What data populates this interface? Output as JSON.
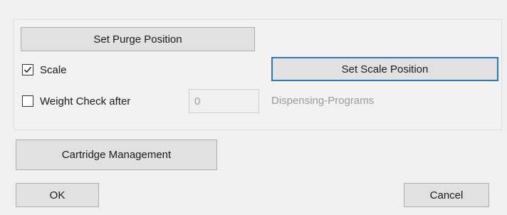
{
  "purge": {
    "set_purge_label": "Set Purge Position"
  },
  "scale": {
    "label": "Scale",
    "checked": true,
    "set_scale_label": "Set Scale Position"
  },
  "weight_check": {
    "label": "Weight Check after",
    "checked": false,
    "value": "0",
    "unit_label": "Dispensing-Programs"
  },
  "cartridge": {
    "label": "Cartridge Management"
  },
  "footer": {
    "ok_label": "OK",
    "cancel_label": "Cancel"
  },
  "icons": {
    "scale_checkbox": "check-icon"
  },
  "colors": {
    "background": "#f0f0f0",
    "button_face": "#e1e1e1",
    "focus_border": "#2a7ab8",
    "disabled_text": "#9a9a9a"
  }
}
